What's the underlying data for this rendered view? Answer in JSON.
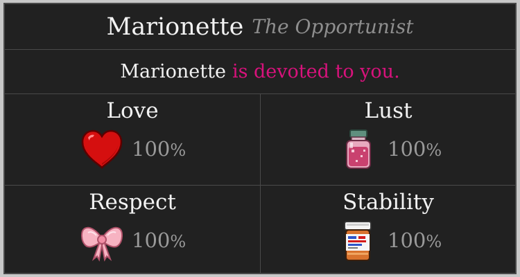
{
  "header": {
    "name": "Marionette",
    "epithet": "The Opportunist"
  },
  "status": {
    "name": "Marionette",
    "text": "is devoted to you.",
    "color": "#d8127c"
  },
  "stats": {
    "love": {
      "label": "Love",
      "value": "100",
      "unit": "%",
      "icon": "heart-icon"
    },
    "lust": {
      "label": "Lust",
      "value": "100",
      "unit": "%",
      "icon": "potion-jar-icon"
    },
    "respect": {
      "label": "Respect",
      "value": "100",
      "unit": "%",
      "icon": "pink-bow-icon"
    },
    "stability": {
      "label": "Stability",
      "value": "100",
      "unit": "%",
      "icon": "pill-bottle-icon"
    }
  }
}
